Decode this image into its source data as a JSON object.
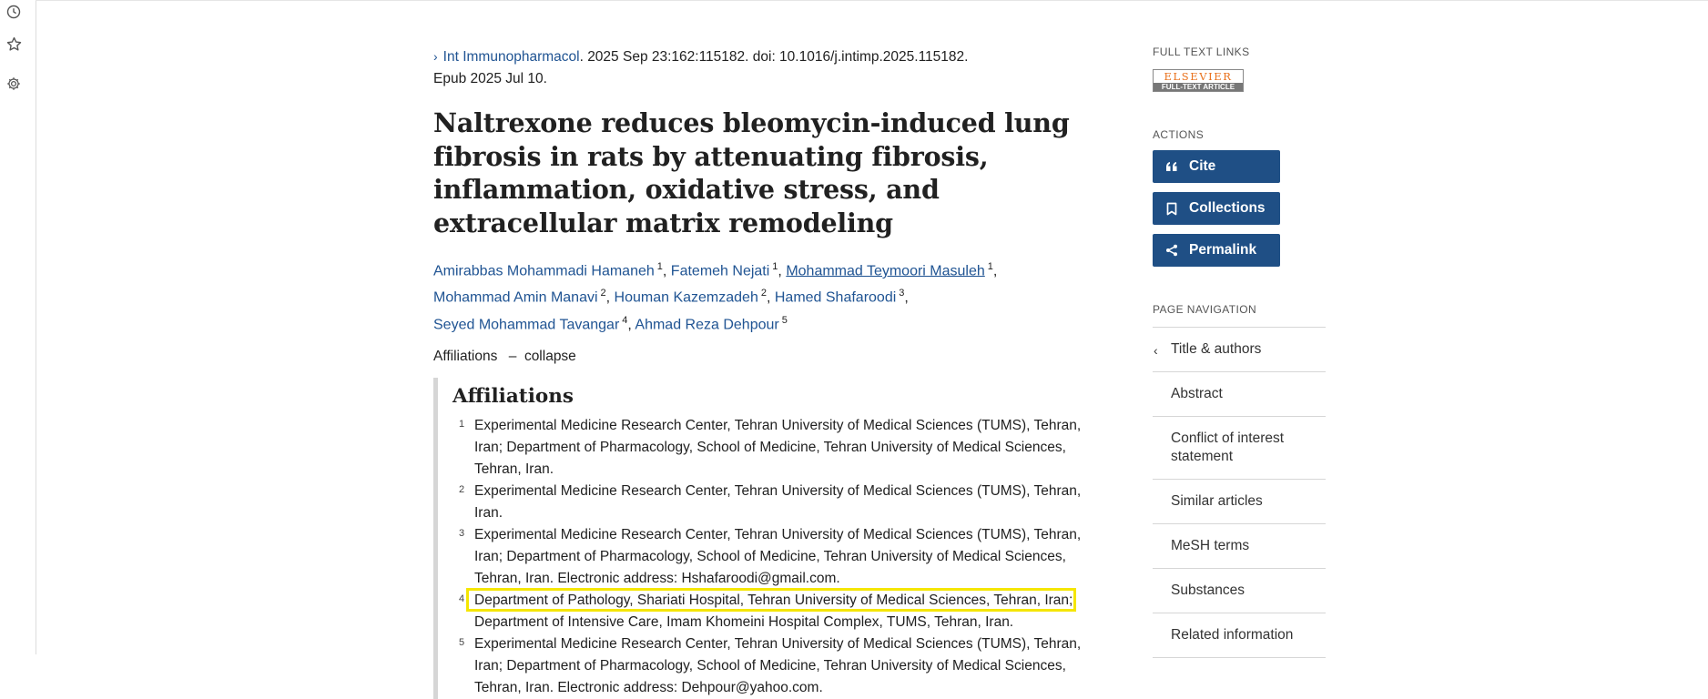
{
  "rail": {
    "icons": [
      "history-icon",
      "star-icon",
      "gear-icon"
    ]
  },
  "citation": {
    "journal": "Int Immunopharmacol",
    "rest1": ". 2025 Sep 23:162:115182. doi: 10.1016/j.intimp.2025.115182.",
    "rest2": "Epub 2025 Jul 10."
  },
  "title": "Naltrexone reduces bleomycin-induced lung fibrosis in rats by attenuating fibrosis, inflammation, oxidative stress, and extracellular matrix remodeling",
  "authors": [
    {
      "name": "Amirabbas Mohammadi Hamaneh",
      "sup": "1"
    },
    {
      "name": "Fatemeh Nejati",
      "sup": "1"
    },
    {
      "name": "Mohammad Teymoori Masuleh",
      "sup": "1"
    },
    {
      "name": "Mohammad Amin Manavi",
      "sup": "2"
    },
    {
      "name": "Houman Kazemzadeh",
      "sup": "2"
    },
    {
      "name": "Hamed Shafaroodi",
      "sup": "3"
    },
    {
      "name": "Seyed Mohammad Tavangar",
      "sup": "4"
    },
    {
      "name": "Ahmad Reza Dehpour",
      "sup": "5"
    }
  ],
  "affiliations_toggle": {
    "label": "Affiliations",
    "dash": "–",
    "action": "collapse"
  },
  "affiliations": {
    "heading": "Affiliations",
    "items": [
      {
        "num": "1",
        "lines": [
          "Experimental Medicine Research Center, Tehran University of Medical Sciences (TUMS), Tehran,",
          "Iran; Department of Pharmacology, School of Medicine, Tehran University of Medical Sciences,",
          "Tehran, Iran."
        ]
      },
      {
        "num": "2",
        "lines": [
          "Experimental Medicine Research Center, Tehran University of Medical Sciences (TUMS), Tehran,",
          "Iran."
        ]
      },
      {
        "num": "3",
        "lines": [
          "Experimental Medicine Research Center, Tehran University of Medical Sciences (TUMS), Tehran,",
          "Iran; Department of Pharmacology, School of Medicine, Tehran University of Medical Sciences,",
          "Tehran, Iran. Electronic address: Hshafaroodi@gmail.com."
        ]
      },
      {
        "num": "4",
        "lines": [
          "Department of Pathology, Shariati Hospital, Tehran University of Medical Sciences, Tehran, Iran;",
          "Department of Intensive Care, Imam Khomeini Hospital Complex, TUMS, Tehran, Iran."
        ]
      },
      {
        "num": "5",
        "lines": [
          "Experimental Medicine Research Center, Tehran University of Medical Sciences (TUMS), Tehran,",
          "Iran; Department of Pharmacology, School of Medicine, Tehran University of Medical Sciences,",
          "Tehran, Iran. Electronic address: Dehpour@yahoo.com."
        ]
      }
    ]
  },
  "sidebar": {
    "full_text_heading": "FULL TEXT LINKS",
    "elsevier_top": "ELSEVIER",
    "elsevier_bottom": "FULL-TEXT ARTICLE",
    "actions_heading": "ACTIONS",
    "buttons": [
      {
        "label": "Cite",
        "icon": "quote-icon"
      },
      {
        "label": "Collections",
        "icon": "bookmark-icon"
      },
      {
        "label": "Permalink",
        "icon": "share-icon"
      }
    ],
    "nav_heading": "PAGE NAVIGATION",
    "nav_items": [
      "Title & authors",
      "Abstract",
      "Conflict of interest statement",
      "Similar articles",
      "MeSH terms",
      "Substances",
      "Related information"
    ]
  },
  "colors": {
    "link": "#205493",
    "button": "#1f4f85",
    "highlight": "#f5e600"
  }
}
